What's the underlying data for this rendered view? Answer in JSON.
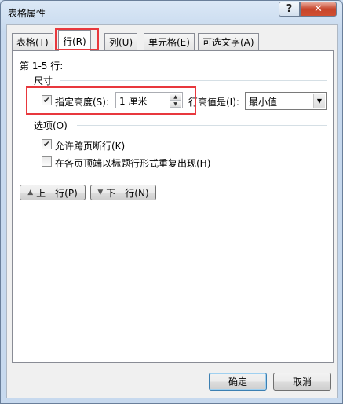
{
  "window": {
    "title": "表格属性",
    "help_label": "?",
    "close_label": "✕"
  },
  "tabs": [
    {
      "label": "表格(T)",
      "active": false
    },
    {
      "label": "行(R)",
      "active": true
    },
    {
      "label": "列(U)",
      "active": false
    },
    {
      "label": "单元格(E)",
      "active": false
    },
    {
      "label": "可选文字(A)",
      "active": false
    }
  ],
  "row_panel": {
    "rows_label": "第 1-5 行:",
    "size_section": "尺寸",
    "specify_height_label": "指定高度(S):",
    "specify_height_checked": true,
    "height_value": "1 厘米",
    "row_height_is_label": "行高值是(I):",
    "row_height_mode": "最小值",
    "options_section": "选项(O)",
    "allow_break_label": "允许跨页断行(K)",
    "allow_break_checked": true,
    "repeat_header_label": "在各页顶端以标题行形式重复出现(H)",
    "repeat_header_checked": false,
    "prev_row_label": "上一行(P)",
    "next_row_label": "下一行(N)"
  },
  "footer": {
    "ok_label": "确定",
    "cancel_label": "取消"
  },
  "colors": {
    "highlight": "#e8383d",
    "close": "#c7452c"
  }
}
